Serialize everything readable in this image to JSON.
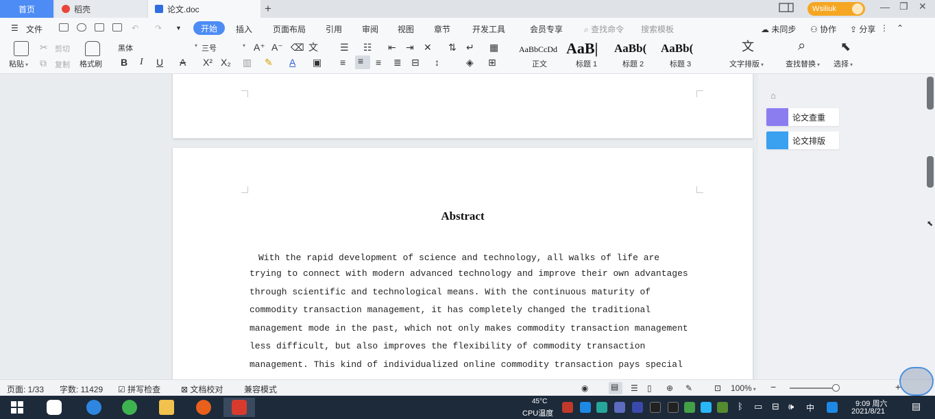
{
  "tabs": {
    "home": "首页",
    "templates": "稻壳",
    "document": "论文.doc"
  },
  "titlebar": {
    "user_name": "Wsiliuk"
  },
  "menu": {
    "file": "文件",
    "start": "开始",
    "insert": "插入",
    "page_layout": "页面布局",
    "references": "引用",
    "review": "审阅",
    "view": "视图",
    "chapter": "章节",
    "devtools": "开发工具",
    "vip": "会员专享",
    "search_command": "查找命令",
    "search_template": "搜索模板",
    "unsynced": "未同步",
    "collaborate": "协作",
    "share": "分享"
  },
  "ribbon": {
    "paste": "粘贴",
    "cut": "剪切",
    "copy": "复制",
    "format_painter": "格式刷",
    "font_name": "黑体",
    "font_size": "三号",
    "style_samples": [
      "AaBbCcDd",
      "AaB|",
      "AaBb(",
      "AaBb("
    ],
    "style_names": [
      "正文",
      "标题 1",
      "标题 2",
      "标题 3"
    ],
    "text_layout": "文字排版",
    "find_replace": "查找替换",
    "select": "选择"
  },
  "document": {
    "abstract_title": "Abstract",
    "abstract_lines": [
      "　With the rapid development of science and technology, all walks of life are",
      "trying to connect with modern advanced technology and improve their own advantages",
      "through scientific and technological means. With the continuous maturity of",
      "commodity transaction management, it has completely changed the traditional",
      "management mode in the past, which not only makes commodity transaction management",
      "less difficult, but also improves the flexibility of commodity transaction",
      "management. This kind of individualized online commodity transaction pays special"
    ]
  },
  "side_panel": {
    "thesis_check": "论文查重",
    "thesis_layout": "论文排版"
  },
  "statusbar": {
    "page": "页面: 1/33",
    "words": "字数: 11429",
    "spell_check": "拼写检查",
    "doc_proofread": "文档校对",
    "compat_mode": "兼容模式",
    "zoom": "100%"
  },
  "taskbar": {
    "cpu_label": "CPU温度",
    "cpu_value": "45°C",
    "ime": "中",
    "time": "9:09 周六",
    "date": "2021/8/21"
  },
  "colors": {
    "accent": "#4d8cf5",
    "user_pill": "#f5a623",
    "taskbar": "#1c2a3a"
  }
}
